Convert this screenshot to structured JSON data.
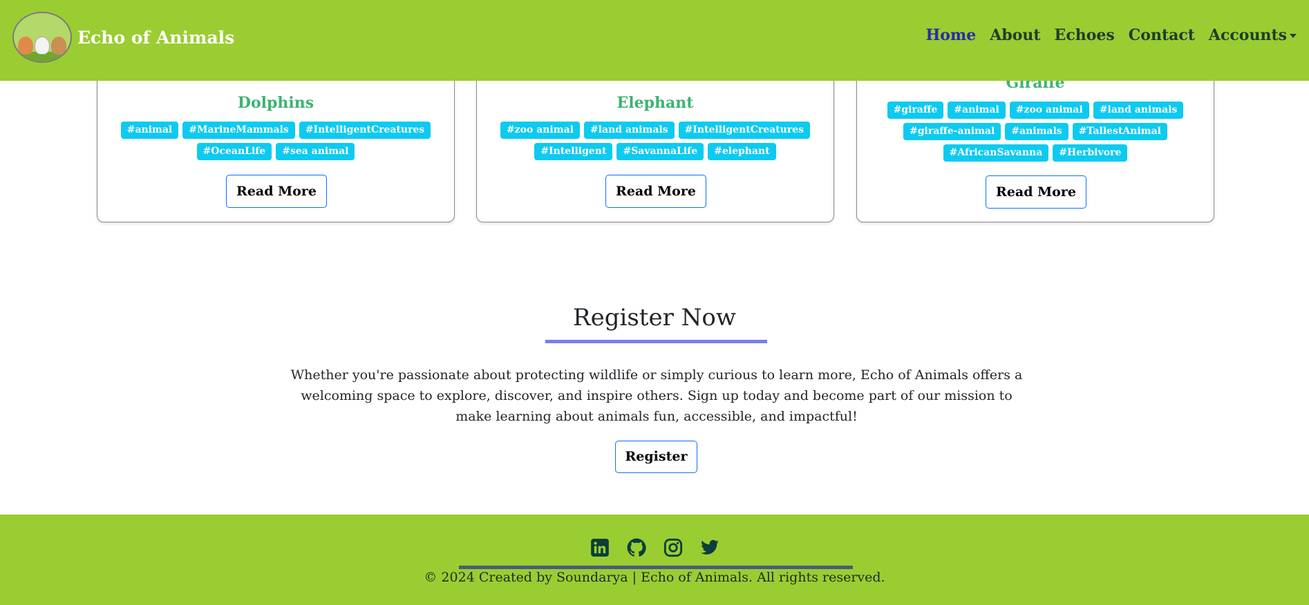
{
  "header": {
    "brand": "Echo of Animals",
    "nav": [
      {
        "label": "Home",
        "active": true
      },
      {
        "label": "About"
      },
      {
        "label": "Echoes"
      },
      {
        "label": "Contact"
      },
      {
        "label": "Accounts",
        "dropdown": true
      }
    ]
  },
  "cards": [
    {
      "title": "Dolphins",
      "tags": [
        "#animal",
        "#MarineMammals",
        "#IntelligentCreatures",
        "#OceanLife",
        "#sea animal"
      ],
      "button": "Read More"
    },
    {
      "title": "Elephant",
      "tags": [
        "#zoo animal",
        "#land animals",
        "#IntelligentCreatures",
        "#Intelligent",
        "#SavannaLife",
        "#elephant"
      ],
      "button": "Read More"
    },
    {
      "title": "Giraffe",
      "tags": [
        "#giraffe",
        "#animal",
        "#zoo animal",
        "#land animals",
        "#giraffe-animal",
        "#animals",
        "#TallestAnimal",
        "#AfricanSavanna",
        "#Herbivore"
      ],
      "button": "Read More"
    }
  ],
  "register": {
    "title": "Register Now",
    "text": "Whether you're passionate about protecting wildlife or simply curious to learn more, Echo of Animals offers a welcoming space to explore, discover, and inspire others. Sign up today and become part of our mission to make learning about animals fun, accessible, and impactful!",
    "button": "Register"
  },
  "footer": {
    "socials": [
      "linkedin-icon",
      "github-icon",
      "instagram-icon",
      "twitter-icon"
    ],
    "copyright": "© 2024 Created by Soundarya | Echo of Animals. All rights reserved."
  },
  "colors": {
    "header_bg": "#9acd32",
    "title_green": "#3cb371",
    "tag_bg": "#0dcaf0",
    "accent_underline": "#7b7bf0",
    "nav_active": "#2a2aa8"
  }
}
